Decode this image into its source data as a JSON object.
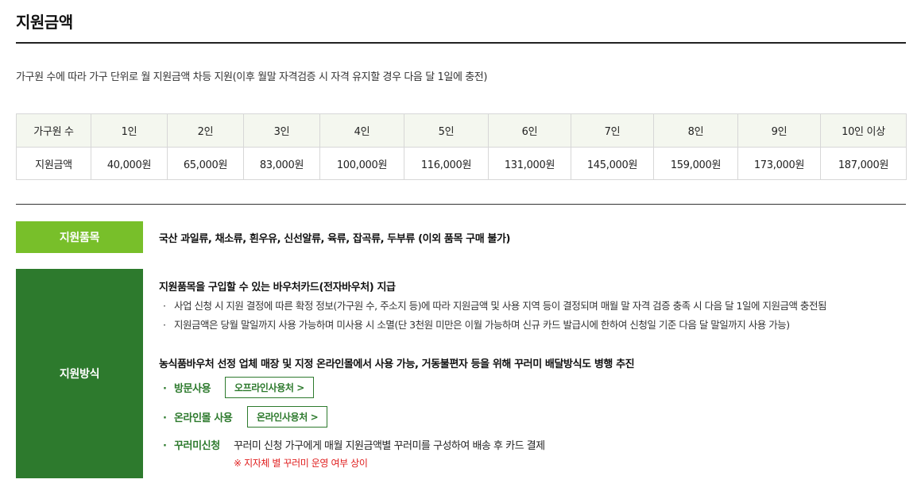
{
  "page": {
    "title": "지원금액",
    "description": "가구원 수에 따라 가구 단위로 월 지원금액 차등 지원(이후 월말 자격검증 시 자격 유지할 경우 다음 달 1일에 충전)"
  },
  "amount_table": {
    "header_label": "가구원 수",
    "row_label": "지원금액",
    "columns": [
      "1인",
      "2인",
      "3인",
      "4인",
      "5인",
      "6인",
      "7인",
      "8인",
      "9인",
      "10인 이상"
    ],
    "amounts": [
      "40,000원",
      "65,000원",
      "83,000원",
      "100,000원",
      "116,000원",
      "131,000원",
      "145,000원",
      "159,000원",
      "173,000원",
      "187,000원"
    ]
  },
  "support_items": {
    "label": "지원품목",
    "text": "국산 과일류, 채소류, 흰우유, 신선알류, 육류, 잡곡류, 두부류 (이외 품목 구매 불가)"
  },
  "support_method": {
    "label": "지원방식",
    "voucher_heading": "지원품목을 구입할 수 있는 바우처카드(전자바우처) 지급",
    "bullet_symbol": "·",
    "bullets": [
      "사업 신청 시 지원 결정에 따른 확정 정보(가구원 수, 주소지 등)에 따라 지원금액 및 사용 지역 등이 결정되며 매월 말 자격 검증 충족 시 다음 달 1일에 지원금액 충전됨",
      "지원금액은 당월 말일까지 사용 가능하며 미사용 시 소멸(단 3천원 미만은 이월 가능하며 신규 카드 발급시에 한하여 신청일 기준 다음 달 말일까지 사용 가능)"
    ],
    "usage_heading": "농식품바우처 선정 업체 매장 및 지정 온라인몰에서 사용 가능, 거동불편자 등을 위해 꾸러미 배달방식도 병행 추진",
    "visit": {
      "label": "방문사용",
      "button": "오프라인사용처 >"
    },
    "online": {
      "label": "온라인몰 사용",
      "button": "온라인사용처 >"
    },
    "package": {
      "label": "꾸러미신청",
      "text": "꾸러미 신청 가구에게 매월 지원금액별 꾸러미를 구성하여 배송 후 카드 결제",
      "note": "※ 지자체 별 꾸러미 운영 여부 상이"
    }
  },
  "colors": {
    "accent_light_green": "#78bf2a",
    "accent_dark_green": "#2d7a2d",
    "note_red": "#e02020",
    "table_header_bg": "#f4f7ef"
  }
}
